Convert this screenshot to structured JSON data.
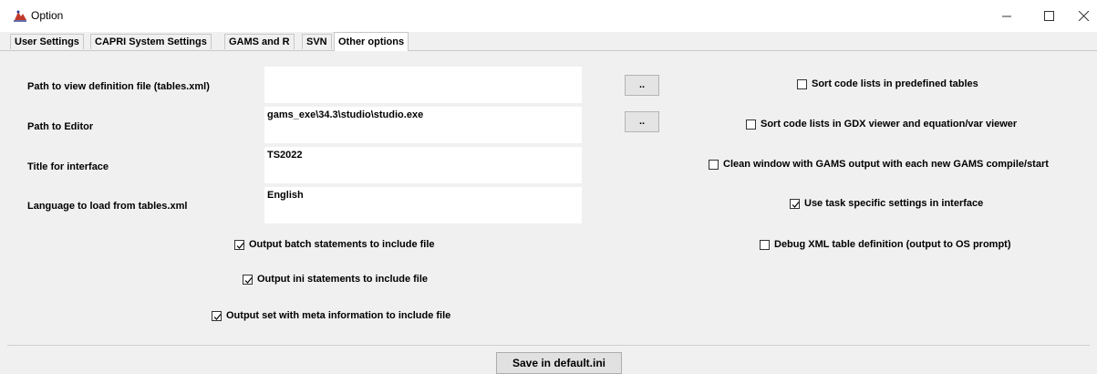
{
  "window": {
    "title": "Option",
    "icon": "java-app-icon"
  },
  "window_controls": {
    "minimize_icon": "minimize-icon",
    "maximize_icon": "maximize-icon",
    "close_icon": "close-icon"
  },
  "tabs": [
    {
      "label": "User Settings",
      "active": false
    },
    {
      "label": "CAPRI System Settings",
      "active": false
    },
    {
      "label": "GAMS and R",
      "active": false
    },
    {
      "label": "SVN",
      "active": false
    },
    {
      "label": "Other options",
      "active": true
    }
  ],
  "fields": [
    {
      "label": "Path to view definition file (tables.xml)",
      "value": "",
      "has_browse": true
    },
    {
      "label": "Path to Editor",
      "value": "gams_exe\\34.3\\studio\\studio.exe",
      "has_browse": true
    },
    {
      "label": "Title for interface",
      "value": "TS2022",
      "has_browse": false
    },
    {
      "label": "Language to load from tables.xml",
      "value": "English",
      "has_browse": false
    }
  ],
  "browse_label": "..",
  "right_options": [
    {
      "label": "Sort code lists in predefined tables",
      "checked": false
    },
    {
      "label": "Sort code lists in GDX viewer and equation/var viewer",
      "checked": false
    },
    {
      "label": "Clean window with GAMS output with each new GAMS compile/start",
      "checked": false
    },
    {
      "label": "Use task specific settings in interface",
      "checked": true
    },
    {
      "label": "Debug XML table definition (output to OS prompt)",
      "checked": false
    }
  ],
  "left_options": [
    {
      "label": "Output batch statements to include file",
      "checked": true
    },
    {
      "label": "Output ini statements to include file",
      "checked": true
    },
    {
      "label": "Output set with meta information to include file",
      "checked": true
    }
  ],
  "save_button": "Save in default.ini"
}
